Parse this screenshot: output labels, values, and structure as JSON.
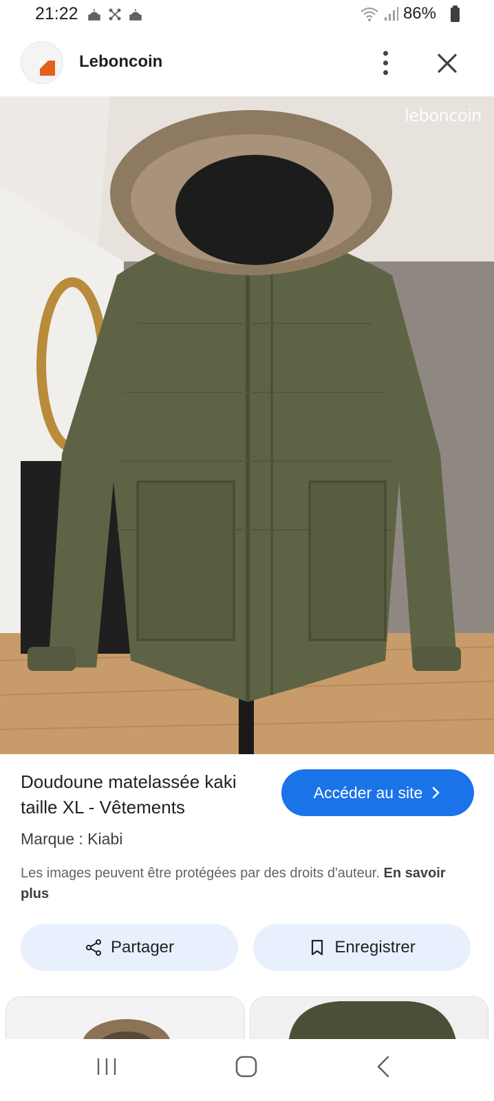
{
  "status_bar": {
    "time": "21:22",
    "battery_percent": "86%",
    "left_icons": [
      "mosque-icon",
      "mesh-network-icon",
      "mosque-icon"
    ],
    "right_icons": [
      "wifi-icon",
      "signal-icon",
      "battery-icon"
    ]
  },
  "header": {
    "site_name": "Leboncoin",
    "logo_color": "#e5601d"
  },
  "image": {
    "watermark": "leboncoin"
  },
  "result": {
    "title": "Doudoune matelassée kaki taille XL - Vêtements",
    "visit_button": "Accéder au site",
    "brand": "Marque : Kiabi",
    "copyright_text": "Les images peuvent être protégées par des droits d'auteur.",
    "learn_more": "En savoir plus"
  },
  "actions": {
    "share_label": "Partager",
    "save_label": "Enregistrer"
  },
  "colors": {
    "accent": "#1a73e8",
    "action_bg": "#e8f0fe"
  }
}
